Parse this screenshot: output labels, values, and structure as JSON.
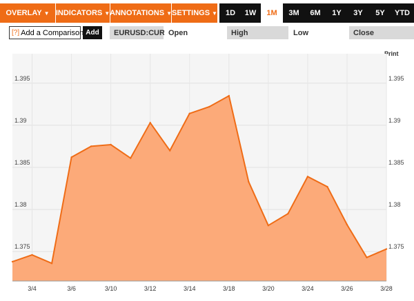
{
  "toolbar": {
    "menus": [
      {
        "label": "OVERLAY",
        "arrow": "▼"
      },
      {
        "label": "INDICATORS",
        "arrow": "▼"
      },
      {
        "label": "ANNOTATIONS",
        "arrow": "▼"
      },
      {
        "label": "SETTINGS",
        "arrow": "▼"
      }
    ],
    "ranges": [
      "1D",
      "1W",
      "1M",
      "3M",
      "6M",
      "1Y",
      "3Y",
      "5Y",
      "YTD"
    ],
    "active_range": "1M"
  },
  "comparison": {
    "help": "[?]",
    "placeholder": "Add a Comparison",
    "add_label": "Add"
  },
  "quote": {
    "symbol": "EURUSD:CUR",
    "open_label": "Open",
    "high_label": "High",
    "low_label": "Low",
    "close_label": "Close"
  },
  "print_label": "Print",
  "colors": {
    "accent": "#ef6c16",
    "area_fill": "#fcaa79",
    "line": "#ef6c16",
    "plot_bg": "#f5f5f5"
  },
  "chart_data": {
    "type": "area",
    "x": [
      "3/3",
      "3/4",
      "3/5",
      "3/6",
      "3/7",
      "3/10",
      "3/11",
      "3/12",
      "3/13",
      "3/14",
      "3/17",
      "3/18",
      "3/19",
      "3/20",
      "3/21",
      "3/24",
      "3/25",
      "3/26",
      "3/27",
      "3/28"
    ],
    "series": [
      {
        "values": [
          1.3738,
          1.3746,
          1.3736,
          1.3862,
          1.3875,
          1.3877,
          1.3861,
          1.3903,
          1.387,
          1.3914,
          1.3922,
          1.3935,
          1.3833,
          1.3781,
          1.3795,
          1.3839,
          1.3827,
          1.3782,
          1.3743,
          1.3753
        ]
      }
    ],
    "x_tick_labels": [
      "3/4",
      "3/6",
      "3/10",
      "3/12",
      "3/14",
      "3/18",
      "3/20",
      "3/24",
      "3/26",
      "3/28"
    ],
    "y_ticks": [
      1.375,
      1.38,
      1.385,
      1.39,
      1.395
    ],
    "y_tick_labels": [
      "1.375",
      "1.38",
      "1.385",
      "1.39",
      "1.395"
    ],
    "ylim": [
      1.3715,
      1.3985
    ],
    "grid": true,
    "title": "",
    "xlabel": "",
    "ylabel": ""
  }
}
